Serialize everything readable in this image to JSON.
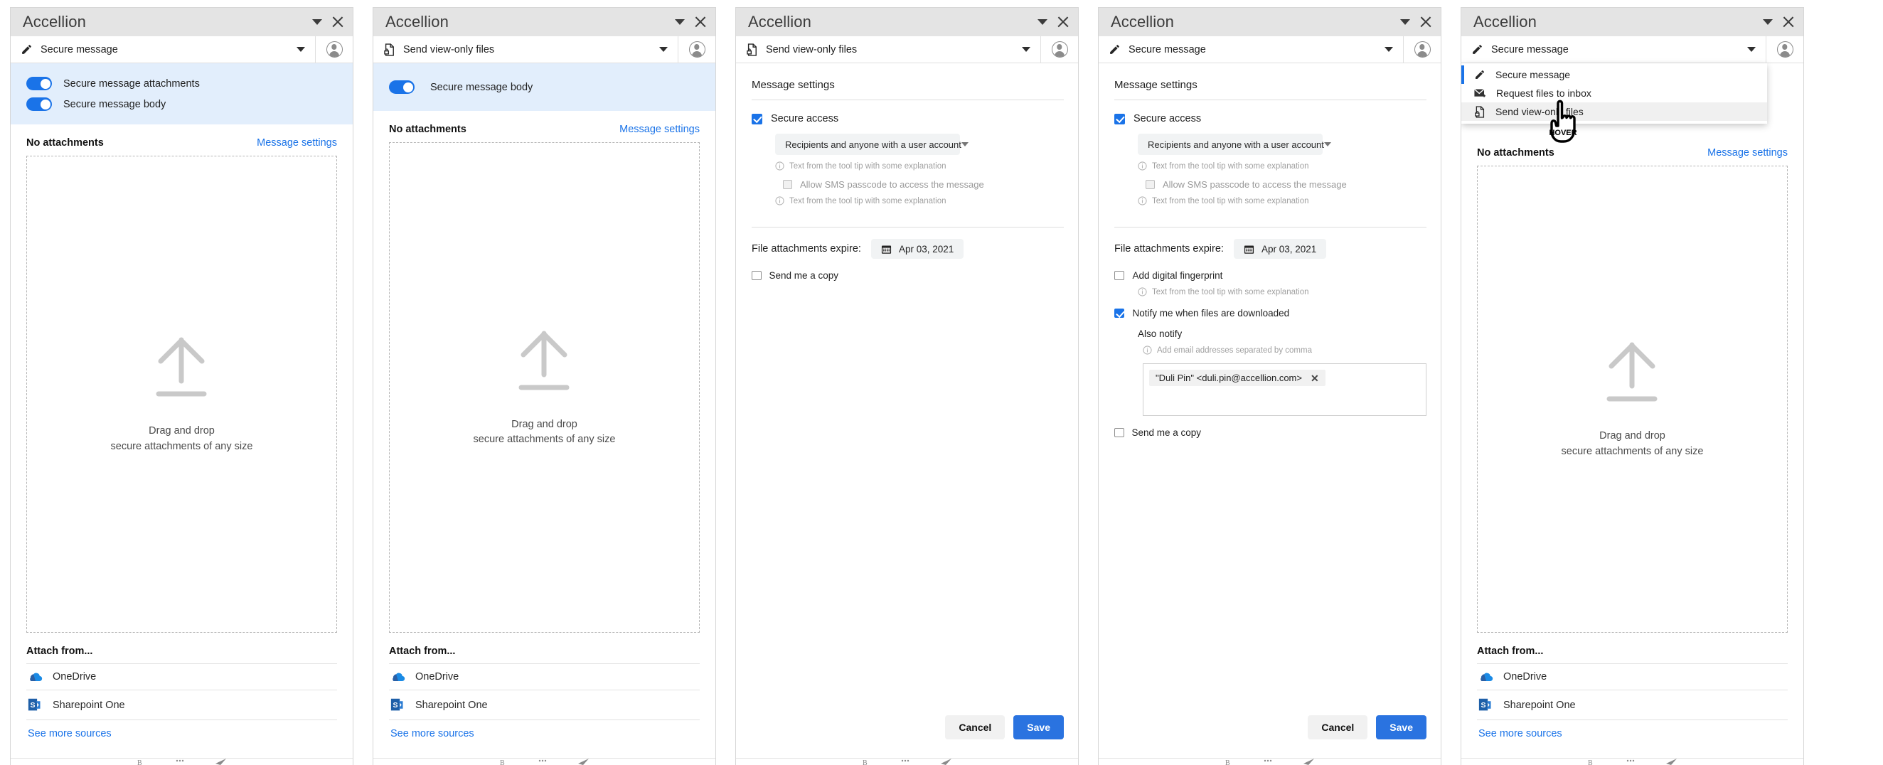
{
  "window": {
    "app_title": "Accellion",
    "minimize_icon": "caret-down-icon",
    "close_icon": "close-icon",
    "avatar_icon": "user-avatar-icon"
  },
  "modes": {
    "secure_message": "Secure message",
    "request_files": "Request files to inbox",
    "send_view_only": "Send view-only files"
  },
  "toggles": {
    "attachments": "Secure message attachments",
    "body": "Secure message body"
  },
  "attachments": {
    "no_attachments": "No attachments",
    "message_settings_link": "Message settings",
    "dropzone_line1": "Drag and drop",
    "dropzone_line2": "secure attachments of any size",
    "upload_icon": "upload-arrow-icon"
  },
  "attach_from": {
    "title": "Attach from...",
    "sources": [
      {
        "label": "OneDrive",
        "icon": "onedrive-icon"
      },
      {
        "label": "Sharepoint One",
        "icon": "sharepoint-icon"
      }
    ],
    "see_more": "See more sources"
  },
  "settings": {
    "title": "Message settings",
    "secure_access": "Secure access",
    "access_scope": "Recipients and anyone with a user account",
    "tooltip_text": "Text from the tool tip with some explanation",
    "allow_sms": "Allow SMS passcode to access the message",
    "expire_label": "File attachments expire:",
    "expire_date": "Apr 03, 2021",
    "calendar_icon": "calendar-icon",
    "send_me_copy": "Send me a copy",
    "add_fingerprint": "Add digital fingerprint",
    "notify_downloaded": "Notify me when files are downloaded",
    "also_notify": "Also notify",
    "also_notify_hint": "Add email addresses separated by comma",
    "email_chip": "\"Duli Pin\" <duli.pin@accellion.com>",
    "chip_remove_icon": "close-icon",
    "cancel": "Cancel",
    "save": "Save"
  },
  "cursor": {
    "label": "HOVER"
  },
  "colors": {
    "accent_blue": "#1a73e8",
    "save_blue": "#2a73e0",
    "titlebar_gray": "#e4e4e4",
    "toggle_strip_blue": "#e2eefc",
    "link_blue": "#1a73e8"
  },
  "panels": [
    {
      "id": "panel-1",
      "mode": "Secure message",
      "mode_icon": "pencil-icon",
      "variant": "compose-two-toggles"
    },
    {
      "id": "panel-2",
      "mode": "Send view-only files",
      "mode_icon": "file-lock-icon",
      "variant": "compose-one-toggle"
    },
    {
      "id": "panel-3",
      "mode": "Send view-only files",
      "mode_icon": "file-lock-icon",
      "variant": "settings-basic"
    },
    {
      "id": "panel-4",
      "mode": "Secure message",
      "mode_icon": "pencil-icon",
      "variant": "settings-extended"
    },
    {
      "id": "panel-5",
      "mode": "Secure message",
      "mode_icon": "pencil-icon",
      "variant": "compose-menu-open"
    }
  ]
}
